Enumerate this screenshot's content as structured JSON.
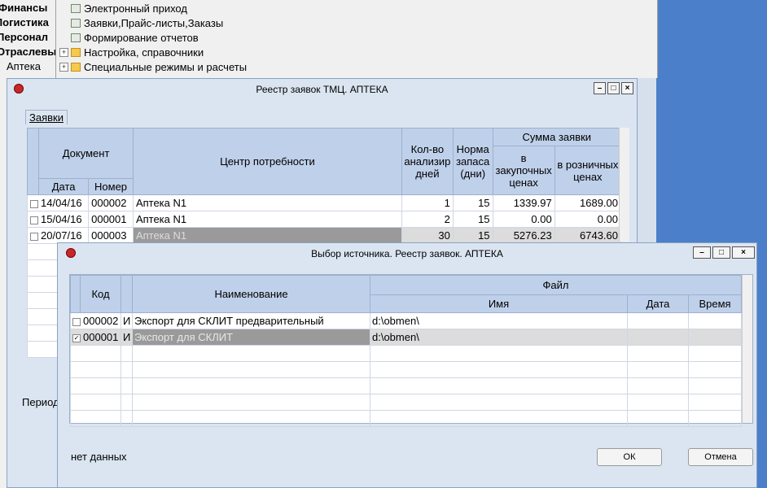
{
  "nav": {
    "items": [
      "Финансы",
      "Логистика",
      "Персонал",
      "Отраслевы",
      "Аптека"
    ]
  },
  "tree": {
    "items": [
      {
        "label": "Электронный приход",
        "icon": "document-icon"
      },
      {
        "label": "Заявки,Прайс-листы,Заказы",
        "icon": "document-icon"
      },
      {
        "label": "Формирование отчетов",
        "icon": "document-icon"
      },
      {
        "label": "Настройка, справочники",
        "icon": "folder-icon"
      },
      {
        "label": "Специальные режимы и расчеты",
        "icon": "folder-icon"
      }
    ]
  },
  "window_registry": {
    "title": "Реестр заявок ТМЦ. АПТЕКА",
    "tab": "Заявки",
    "headers": {
      "document": "Документ",
      "date": "Дата",
      "number": "Номер",
      "center": "Центр потребности",
      "analysis_days": "Кол-во анализир дней",
      "stock_norm": "Норма запаса (дни)",
      "sum": "Сумма заявки",
      "purchase": "в закупочных ценах",
      "retail": "в розничных ценах"
    },
    "rows": [
      {
        "date": "14/04/16",
        "number": "000002",
        "center": "Аптека N1",
        "days": "1",
        "norm": "15",
        "purchase": "1339.97",
        "retail": "1689.00",
        "selected": false
      },
      {
        "date": "15/04/16",
        "number": "000001",
        "center": "Аптека N1",
        "days": "2",
        "norm": "15",
        "purchase": "0.00",
        "retail": "0.00",
        "selected": false
      },
      {
        "date": "20/07/16",
        "number": "000003",
        "center": "Аптека N1",
        "days": "30",
        "norm": "15",
        "purchase": "5276.23",
        "retail": "6743.60",
        "selected": true
      }
    ],
    "period_label": "Период"
  },
  "window_source": {
    "title": "Выбор источника. Реестр заявок.  АПТЕКА",
    "headers": {
      "code": "Код",
      "name": "Наименование",
      "file": "Файл",
      "file_name": "Имя",
      "date": "Дата",
      "time": "Время"
    },
    "rows": [
      {
        "code": "000002",
        "flag": "И",
        "name": "Экспорт для СКЛИТ предварительный",
        "file": "d:\\obmen\\",
        "checked": false
      },
      {
        "code": "000001",
        "flag": "И",
        "name": "Экспорт для СКЛИТ",
        "file": "d:\\obmen\\",
        "checked": true
      }
    ],
    "status": "нет данных",
    "ok_label": "ОК",
    "cancel_label": "Отмена"
  }
}
